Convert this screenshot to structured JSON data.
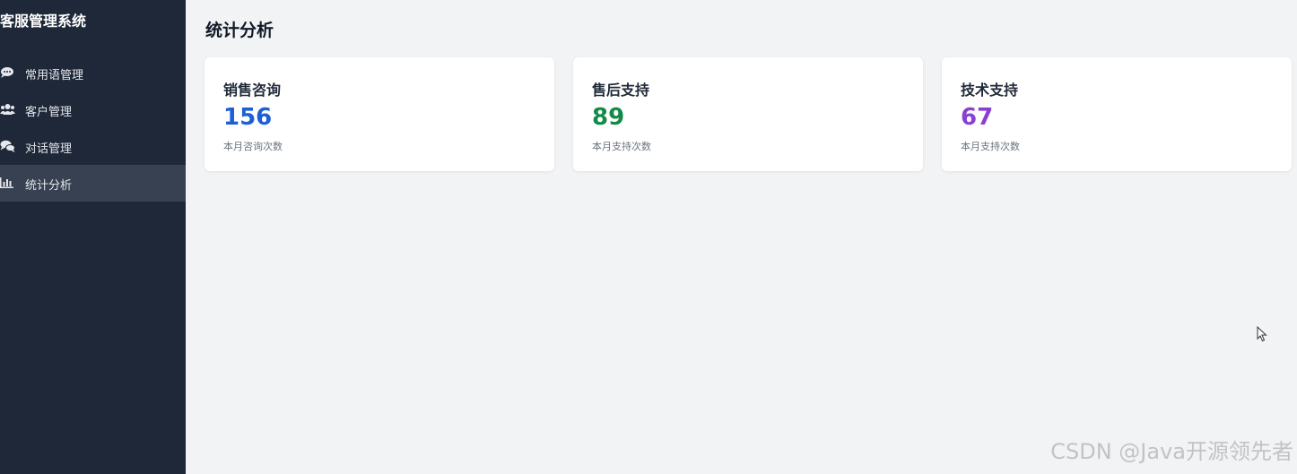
{
  "app": {
    "title": "客服管理系统"
  },
  "sidebar": {
    "items": [
      {
        "label": "常用语管理",
        "icon": "comment-icon",
        "active": false
      },
      {
        "label": "客户管理",
        "icon": "users-icon",
        "active": false
      },
      {
        "label": "对话管理",
        "icon": "comments-icon",
        "active": false
      },
      {
        "label": "统计分析",
        "icon": "bar-chart-icon",
        "active": true
      }
    ]
  },
  "main": {
    "title": "统计分析",
    "cards": [
      {
        "title": "销售咨询",
        "value": "156",
        "caption": "本月咨询次数",
        "color": "#1d5fd6"
      },
      {
        "title": "售后支持",
        "value": "89",
        "caption": "本月支持次数",
        "color": "#138a48"
      },
      {
        "title": "技术支持",
        "value": "67",
        "caption": "本月支持次数",
        "color": "#8a3fd1"
      }
    ]
  },
  "watermark": "CSDN @Java开源领先者",
  "colors": {
    "sidebar_bg": "#1e2839",
    "sidebar_active_bg": "#374151",
    "page_bg": "#f2f3f5"
  }
}
